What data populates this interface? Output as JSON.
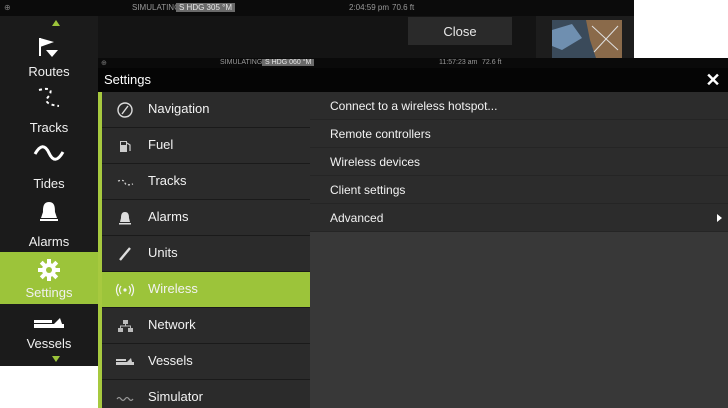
{
  "back_screen": {
    "status": {
      "sim_label": "SIMULATING...",
      "heading": "S HDG 305 °M",
      "time": "2:04:59 pm",
      "depth": "70.6 ft"
    },
    "close_label": "Close",
    "sidebar": [
      {
        "label": "Routes",
        "icon": "routes-icon"
      },
      {
        "label": "Tracks",
        "icon": "tracks-icon"
      },
      {
        "label": "Tides",
        "icon": "tides-icon"
      },
      {
        "label": "Alarms",
        "icon": "alarm-bell-icon"
      },
      {
        "label": "Settings",
        "icon": "gear-icon",
        "active": true
      },
      {
        "label": "Vessels",
        "icon": "vessels-icon"
      }
    ]
  },
  "settings": {
    "status": {
      "sim_label": "SIMULATING...",
      "heading": "S HDG 060 °M",
      "time": "11:57:23 am",
      "depth": "72.6 ft"
    },
    "title": "Settings",
    "close_symbol": "✕",
    "menu": [
      {
        "label": "Navigation",
        "icon": "compass-icon"
      },
      {
        "label": "Fuel",
        "icon": "fuel-pump-icon"
      },
      {
        "label": "Tracks",
        "icon": "tracks-icon"
      },
      {
        "label": "Alarms",
        "icon": "alarm-bell-icon"
      },
      {
        "label": "Units",
        "icon": "ruler-icon"
      },
      {
        "label": "Wireless",
        "icon": "wireless-icon",
        "active": true
      },
      {
        "label": "Network",
        "icon": "network-icon"
      },
      {
        "label": "Vessels",
        "icon": "vessels-icon"
      },
      {
        "label": "Simulator",
        "icon": "simulator-icon"
      }
    ],
    "options": [
      {
        "label": "Connect to a wireless hotspot..."
      },
      {
        "label": "Remote controllers"
      },
      {
        "label": "Wireless devices"
      },
      {
        "label": "Client settings"
      },
      {
        "label": "Advanced",
        "has_submenu": true
      }
    ]
  },
  "colors": {
    "accent": "#9cc43a",
    "window_bg": "#1e1e1e",
    "panel_bg": "#383838"
  }
}
